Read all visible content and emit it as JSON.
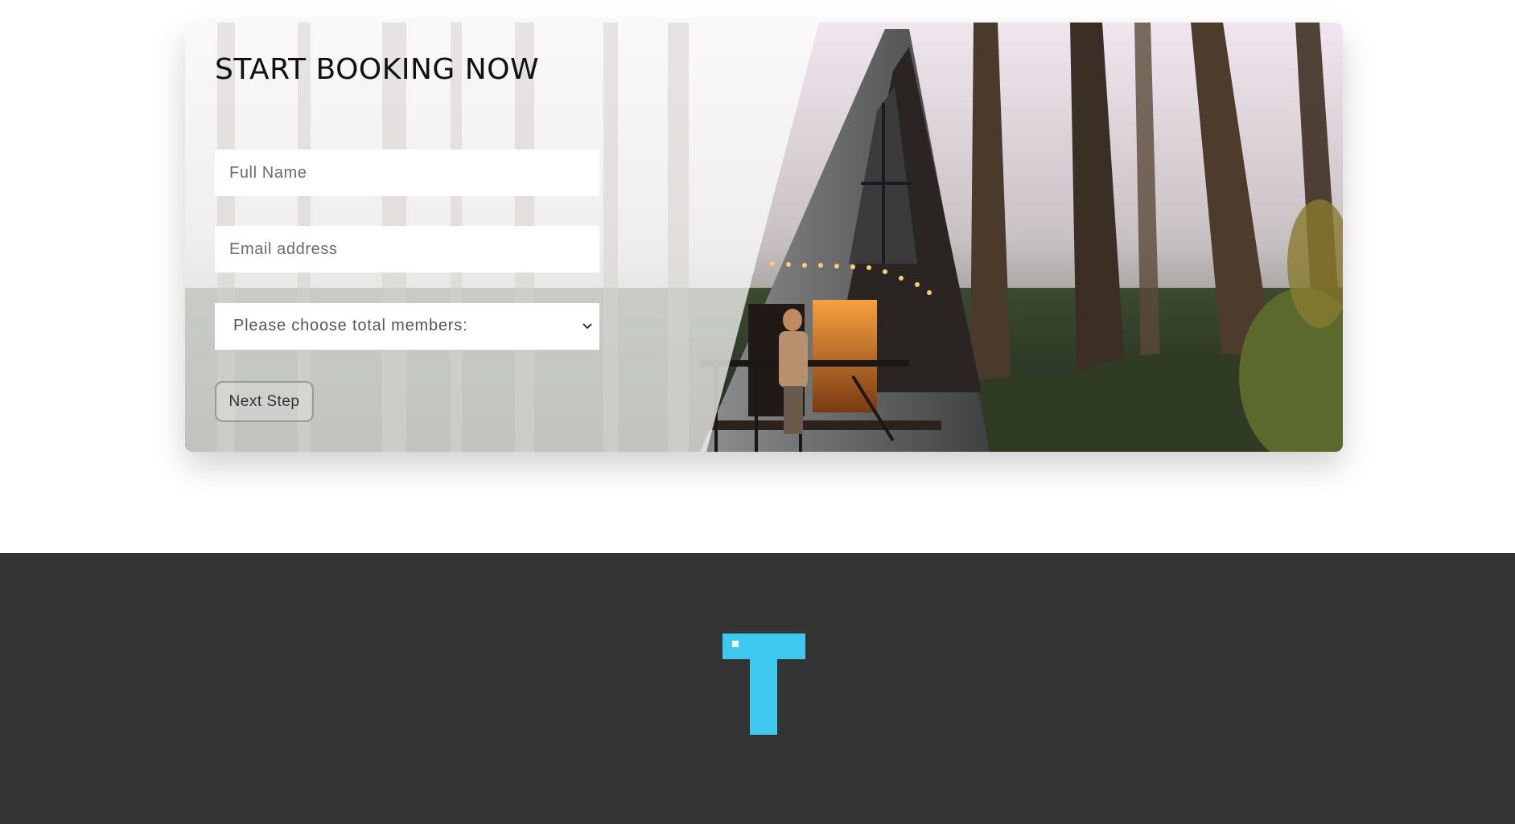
{
  "booking": {
    "title": "START BOOKING NOW",
    "full_name_placeholder": "Full Name",
    "email_placeholder": "Email address",
    "members_select_value": "Please choose total members:",
    "next_button_label": "Next Step"
  },
  "image": {
    "subject": "a-frame-cabin-in-forest"
  },
  "footer": {
    "logo_color": "#3fc8ef",
    "background_color": "#333333"
  }
}
